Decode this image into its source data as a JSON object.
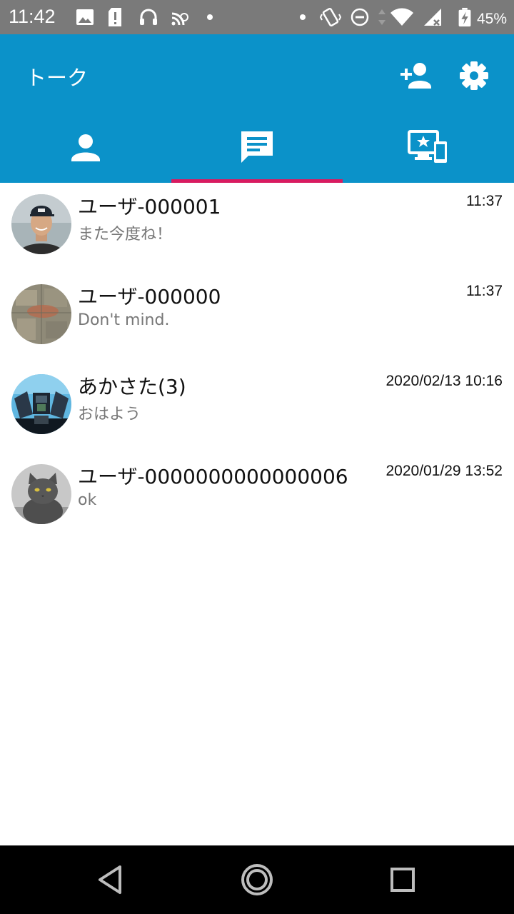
{
  "status_bar": {
    "time": "11:42",
    "battery": "45%",
    "icons": [
      "image-icon",
      "sd-card-alert-icon",
      "headphones-icon",
      "cast-off-icon",
      "dot-icon",
      "dot-icon",
      "vibrate-icon",
      "do-not-disturb-icon",
      "data-arrows-icon",
      "wifi-icon",
      "no-signal-icon",
      "battery-charging-icon"
    ]
  },
  "app_bar": {
    "title": "トーク",
    "actions": [
      "add-friend-icon",
      "settings-icon"
    ]
  },
  "tabs": [
    {
      "name": "tab-friends",
      "icon": "person-icon",
      "selected": false
    },
    {
      "name": "tab-talk",
      "icon": "chat-icon",
      "selected": true
    },
    {
      "name": "tab-devices",
      "icon": "devices-icon",
      "selected": false
    }
  ],
  "colors": {
    "app_bar": "#0b92c9",
    "tab_indicator": "#d81b60",
    "status_bar": "#7a7a7a",
    "message_text": "#777777"
  },
  "talks": [
    {
      "name": "ユーザ-000001",
      "message": "また今度ね！",
      "time": "11:37",
      "avatar": "man-with-cap-photo"
    },
    {
      "name": "ユーザ-000000",
      "message": "Don't  mind.",
      "time": "11:37",
      "avatar": "map-photo"
    },
    {
      "name": "あかさた(3)",
      "message": "おはよう",
      "time": "2020/02/13 10:16",
      "avatar": "machine-photo"
    },
    {
      "name": "ユーザ-0000000000000006",
      "message": "ok",
      "time": "2020/01/29 13:52",
      "avatar": "gray-cat-photo"
    }
  ],
  "nav_bar": [
    "back-icon",
    "home-icon",
    "recents-icon"
  ]
}
